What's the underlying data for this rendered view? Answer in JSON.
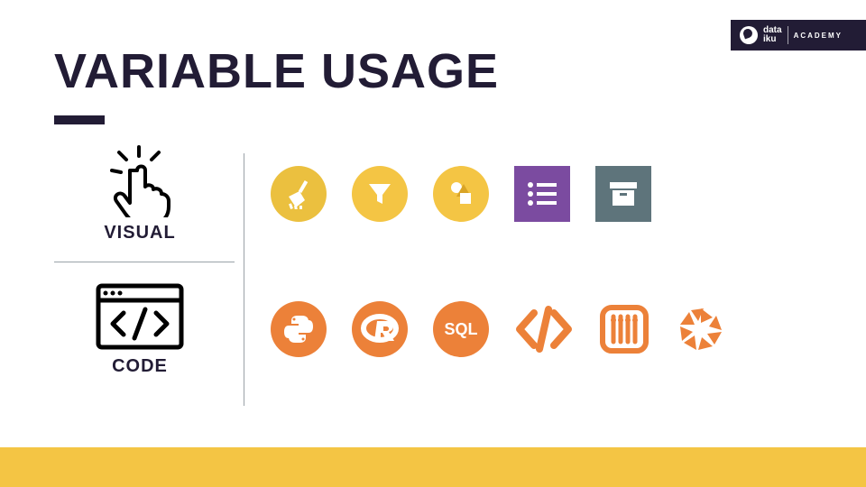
{
  "title": "VARIABLE USAGE",
  "brand": {
    "name_line1": "data",
    "name_line2": "iku",
    "academy": "ACADEMY"
  },
  "rows": {
    "visual": {
      "label": "VISUAL",
      "icons": [
        "broom-icon",
        "funnel-icon",
        "shapes-icon",
        "list-icon",
        "archive-icon"
      ]
    },
    "code": {
      "label": "CODE",
      "icons": [
        "python-icon",
        "r-icon",
        "sql-icon",
        "code-brackets-icon",
        "abacus-icon",
        "aperture-icon"
      ]
    }
  }
}
